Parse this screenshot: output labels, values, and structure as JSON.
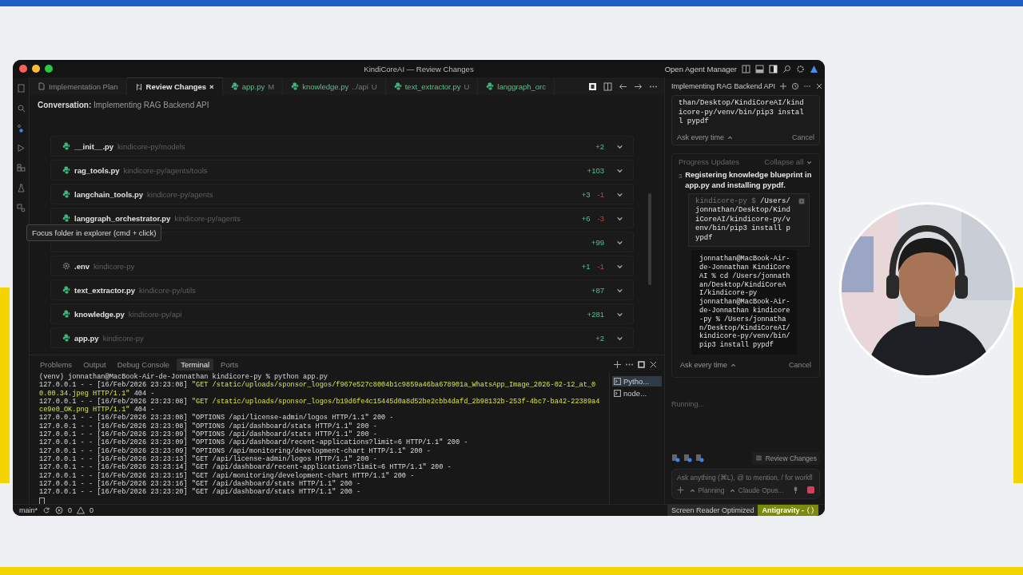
{
  "window": {
    "title": "KindiCoreAI — Review Changes",
    "agent_manager": "Open Agent Manager"
  },
  "tabs": [
    {
      "label": "Implementation Plan",
      "kind": "doc",
      "selected": false
    },
    {
      "label": "Review Changes",
      "kind": "diff",
      "selected": true,
      "close": "×"
    },
    {
      "label": "app.py",
      "kind": "py",
      "status": "M",
      "selected": false
    },
    {
      "label": "knowledge.py",
      "kind": "py",
      "path": "../api",
      "status": "U",
      "selected": false
    },
    {
      "label": "text_extractor.py",
      "kind": "py",
      "status": "U",
      "selected": false
    },
    {
      "label": "langgraph_orc",
      "kind": "py",
      "selected": false
    }
  ],
  "conversation": {
    "label": "Conversation:",
    "title": "Implementing RAG Backend API"
  },
  "files": [
    {
      "kind": "py",
      "name": "__init__.py",
      "path": "kindicore-py/models",
      "added": "+2"
    },
    {
      "kind": "py",
      "name": "rag_tools.py",
      "path": "kindicore-py/agents/tools",
      "added": "+103"
    },
    {
      "kind": "py",
      "name": "langchain_tools.py",
      "path": "kindicore-py/agents",
      "added": "+3",
      "removed": "-1"
    },
    {
      "kind": "py",
      "name": "langgraph_orchestrator.py",
      "path": "kindicore-py/agents",
      "added": "+6",
      "removed": "-3"
    },
    {
      "kind": "covered",
      "added": "+99"
    },
    {
      "kind": "config",
      "name": ".env",
      "path": "kindicore-py",
      "added": "+1",
      "removed": "-1"
    },
    {
      "kind": "py",
      "name": "text_extractor.py",
      "path": "kindicore-py/utils",
      "added": "+87"
    },
    {
      "kind": "py",
      "name": "knowledge.py",
      "path": "kindicore-py/api",
      "added": "+281"
    },
    {
      "kind": "py",
      "name": "app.py",
      "path": "kindicore-py",
      "added": "+2"
    }
  ],
  "tooltip": "Focus folder in explorer (cmd + click)",
  "panel": {
    "tabs": [
      {
        "label": "Problems",
        "selected": false
      },
      {
        "label": "Output",
        "selected": false
      },
      {
        "label": "Debug Console",
        "selected": false
      },
      {
        "label": "Terminal",
        "selected": true
      },
      {
        "label": "Ports",
        "selected": false
      }
    ],
    "prompt": "(venv) jonnathan@MacBook-Air-de-Jonnathan kindicore-py % python app.py",
    "lines": [
      {
        "prefix": "127.0.0.1 - - [16/Feb/2026 23:23:08] ",
        "request": "\"GET /static/uploads/sponsor_logos/f967e527c8004b1c9859a46ba678901a_WhatsApp_Image_2026-02-12_at_00.00.34.jpeg HTTP/1.1\"",
        "suffix": " 404 -",
        "highlight": true
      },
      {
        "prefix": "127.0.0.1 - - [16/Feb/2026 23:23:08] ",
        "request": "\"GET /static/uploads/sponsor_logos/b19d6fe4c15445d0a8d52be2cbb4dafd_2b98132b-253f-4bc7-ba42-22389a4ce9e0_OK.png HTTP/1.1\"",
        "suffix": " 404 -",
        "highlight": true
      },
      {
        "prefix": "127.0.0.1 - - [16/Feb/2026 23:23:08] ",
        "request": "\"OPTIONS /api/license-admin/logos HTTP/1.1\"",
        "suffix": " 200 -",
        "highlight": false
      },
      {
        "prefix": "127.0.0.1 - - [16/Feb/2026 23:23:08] ",
        "request": "\"OPTIONS /api/dashboard/stats HTTP/1.1\"",
        "suffix": " 200 -",
        "highlight": false
      },
      {
        "prefix": "127.0.0.1 - - [16/Feb/2026 23:23:09] ",
        "request": "\"OPTIONS /api/dashboard/stats HTTP/1.1\"",
        "suffix": " 200 -",
        "highlight": false
      },
      {
        "prefix": "127.0.0.1 - - [16/Feb/2026 23:23:09] ",
        "request": "\"OPTIONS /api/dashboard/recent-applications?limit=6 HTTP/1.1\"",
        "suffix": " 200 -",
        "highlight": false
      },
      {
        "prefix": "127.0.0.1 - - [16/Feb/2026 23:23:09] ",
        "request": "\"OPTIONS /api/monitoring/development-chart HTTP/1.1\"",
        "suffix": " 200 -",
        "highlight": false
      },
      {
        "prefix": "127.0.0.1 - - [16/Feb/2026 23:23:13] ",
        "request": "\"GET /api/license-admin/logos HTTP/1.1\"",
        "suffix": " 200 -",
        "highlight": false
      },
      {
        "prefix": "127.0.0.1 - - [16/Feb/2026 23:23:14] ",
        "request": "\"GET /api/dashboard/recent-applications?limit=6 HTTP/1.1\"",
        "suffix": " 200 -",
        "highlight": false
      },
      {
        "prefix": "127.0.0.1 - - [16/Feb/2026 23:23:15] ",
        "request": "\"GET /api/monitoring/development-chart HTTP/1.1\"",
        "suffix": " 200 -",
        "highlight": false
      },
      {
        "prefix": "127.0.0.1 - - [16/Feb/2026 23:23:16] ",
        "request": "\"GET /api/dashboard/stats HTTP/1.1\"",
        "suffix": " 200 -",
        "highlight": false
      },
      {
        "prefix": "127.0.0.1 - - [16/Feb/2026 23:23:20] ",
        "request": "\"GET /api/dashboard/stats HTTP/1.1\"",
        "suffix": " 200 -",
        "highlight": false
      }
    ],
    "terminals": [
      {
        "label": "Pytho...",
        "selected": true
      },
      {
        "label": "node...",
        "selected": false
      }
    ]
  },
  "status_bar": {
    "branch": "main*",
    "errors": "0",
    "warnings": "0",
    "right": [
      {
        "label": "Screen Reader Optimized",
        "kind": "plain"
      },
      {
        "label": "Antigravity -",
        "kind": "accent"
      }
    ]
  },
  "agent": {
    "title": "Implementing RAG Backend API",
    "top_card": {
      "command": "than/Desktop/KindiCoreAI/kindicore-py/venv/bin/pip3 install pypdf",
      "ask": "Ask every time",
      "cancel": "Cancel"
    },
    "progress": {
      "title": "Progress Updates",
      "collapse": "Collapse all",
      "step": "3",
      "text": "Registering knowledge blueprint in app.py and installing pypdf.",
      "prompt": "kindicore-py $",
      "command": "/Users/jonnathan/Desktop/KindiCoreAI/kindicore-py/venv/bin/pip3 install pypdf",
      "output": [
        "jonnathan@MacBook-Air-de-Jonnathan KindiCoreAI % cd /Users/jonnathan/Desktop/KindiCoreAI/kindicore-py",
        "jonnathan@MacBook-Air-de-Jonnathan kindicore-py % /Users/jonnathan/Desktop/KindiCoreAI/kindicore-py/venv/bin/pip3 install pypdf"
      ],
      "ask": "Ask every time",
      "cancel": "Cancel"
    },
    "status": "Running...",
    "review_button": "Review Changes",
    "input": {
      "placeholder": "Ask anything (⌘L), @ to mention, / for workfl"
    },
    "mode": "Planning",
    "model": "Claude Opus..."
  }
}
